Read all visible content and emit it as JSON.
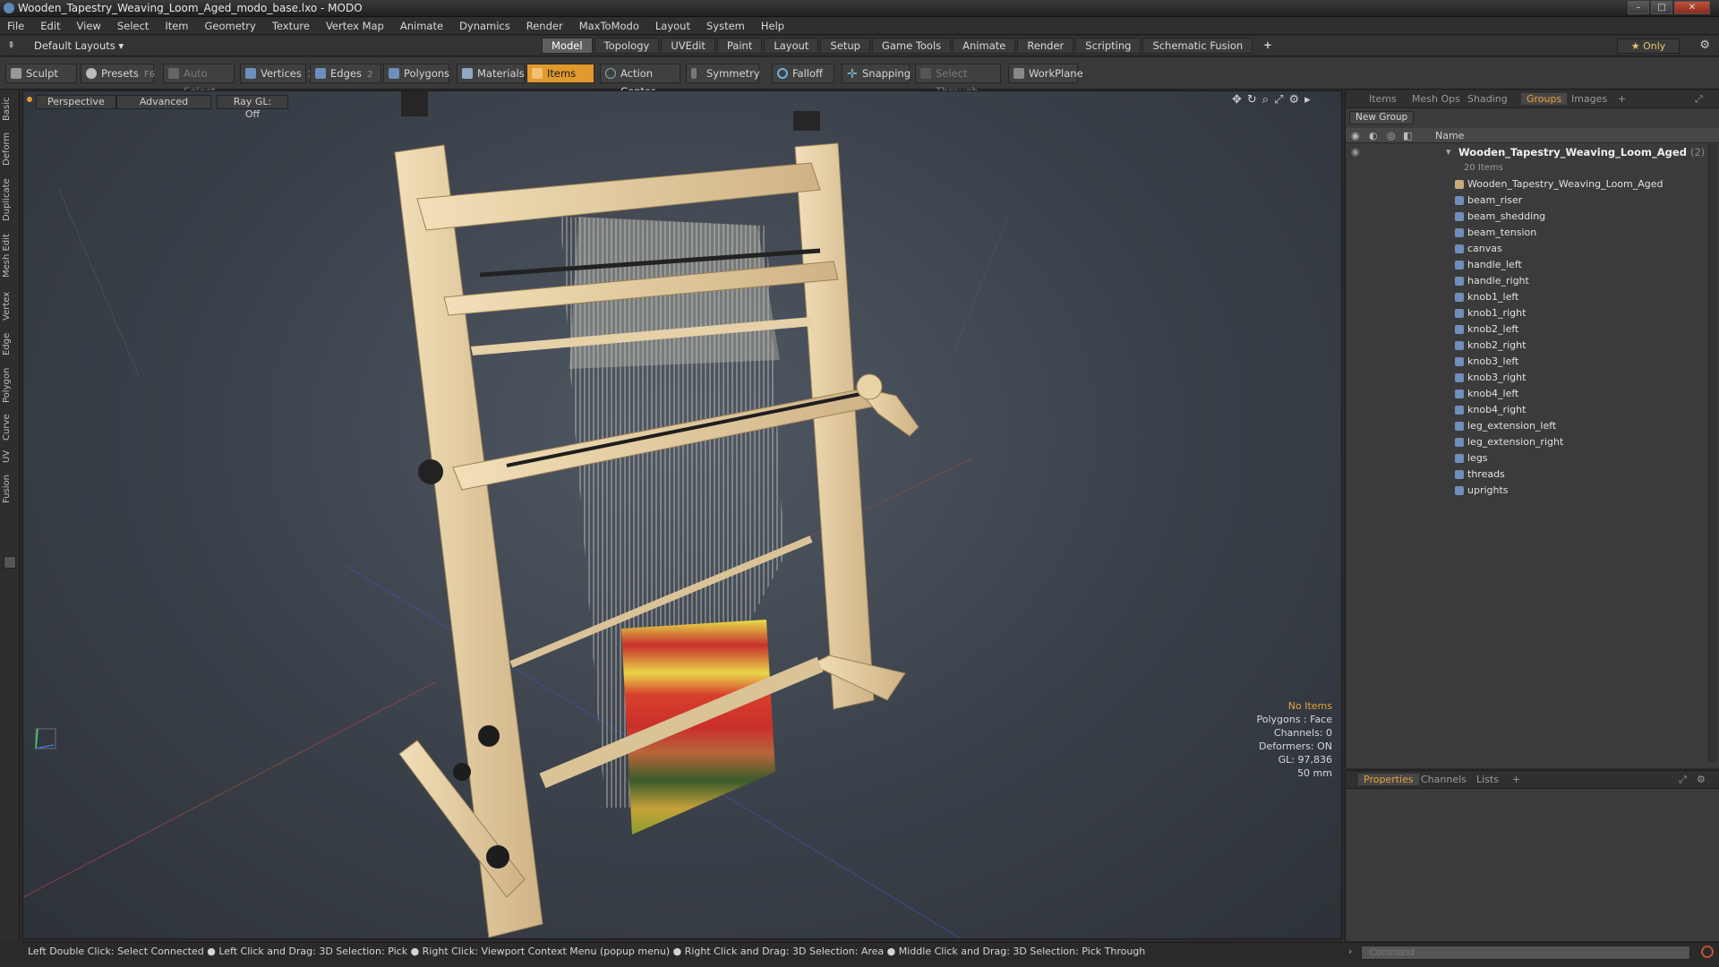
{
  "window": {
    "title": "Wooden_Tapestry_Weaving_Loom_Aged_modo_base.lxo - MODO"
  },
  "menu": [
    "File",
    "Edit",
    "View",
    "Select",
    "Item",
    "Geometry",
    "Texture",
    "Vertex Map",
    "Animate",
    "Dynamics",
    "Render",
    "MaxToModo",
    "Layout",
    "System",
    "Help"
  ],
  "layout_selector": "Default Layouts ▾",
  "mode_tabs": [
    "Model",
    "Topology",
    "UVEdit",
    "Paint",
    "Layout",
    "Setup",
    "Game Tools",
    "Animate",
    "Render",
    "Scripting",
    "Schematic Fusion"
  ],
  "only_label": "★  Only",
  "toolbar": {
    "sculpt": "Sculpt",
    "presets": "Presets",
    "presets_key": "F6",
    "auto_select": "Auto Select",
    "vertices": "Vertices",
    "vertices_key": "1",
    "edges": "Edges",
    "edges_key": "2",
    "polygons": "Polygons",
    "materials": "Materials",
    "items": "Items",
    "action_center": "Action Center",
    "symmetry": "Symmetry",
    "falloff": "Falloff",
    "snapping": "Snapping",
    "select_through": "Select Through",
    "workplane": "WorkPlane"
  },
  "left_tabs": [
    "Basic",
    "Deform",
    "Duplicate",
    "Mesh Edit",
    "Vertex",
    "Edge",
    "Polygon",
    "Curve",
    "UV",
    "Fusion"
  ],
  "viewport": {
    "tabs": [
      "Perspective",
      "Advanced",
      "Ray GL: Off"
    ],
    "info": {
      "no_items": "No Items",
      "polygons": "Polygons : Face",
      "channels": "Channels: 0",
      "deformers": "Deformers: ON",
      "gl": "GL: 97,836",
      "scale": "50 mm"
    }
  },
  "right_panel": {
    "tabs": [
      "Items",
      "Mesh Ops",
      "Shading",
      "Groups",
      "Images"
    ],
    "new_group": "New Group",
    "name_header": "Name",
    "group_name": "Wooden_Tapestry_Weaving_Loom_Aged",
    "group_count": "(2)",
    "group_sub": "20 Items",
    "items": [
      "Wooden_Tapestry_Weaving_Loom_Aged",
      "beam_riser",
      "beam_shedding",
      "beam_tension",
      "canvas",
      "handle_left",
      "handle_right",
      "knob1_left",
      "knob1_right",
      "knob2_left",
      "knob2_right",
      "knob3_left",
      "knob3_right",
      "knob4_left",
      "knob4_right",
      "leg_extension_left",
      "leg_extension_right",
      "legs",
      "threads",
      "uprights"
    ]
  },
  "prop_panel": {
    "tabs": [
      "Properties",
      "Channels",
      "Lists"
    ]
  },
  "statusbar": "Left Double Click: Select Connected ● Left Click and Drag: 3D Selection: Pick ● Right Click: Viewport Context Menu (popup menu) ● Right Click and Drag: 3D Selection: Area ● Middle Click and Drag: 3D Selection: Pick Through",
  "command": {
    "placeholder": "Command"
  },
  "colors": {
    "accent": "#e09a2e",
    "wood": "#e8d3a6",
    "tab_active": "#e6a23a"
  }
}
